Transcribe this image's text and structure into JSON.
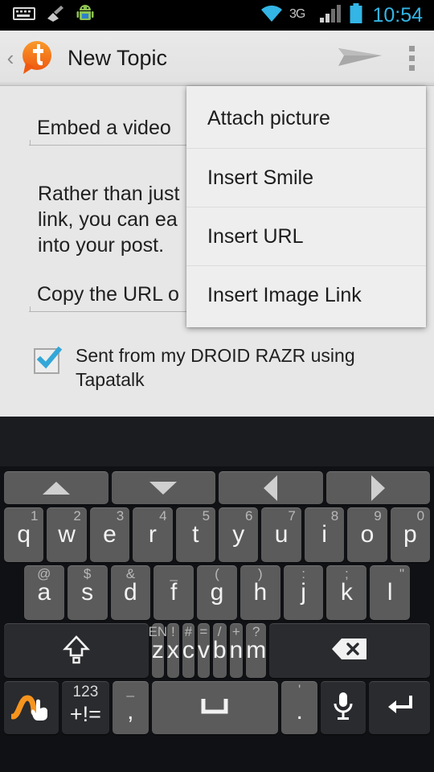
{
  "statusbar": {
    "time": "10:54",
    "network": "3G",
    "icons": [
      "keyboard-icon",
      "brush-icon",
      "android-robot-icon",
      "wifi-icon",
      "3g-label",
      "signal-icon",
      "battery-icon"
    ]
  },
  "actionbar": {
    "back_label": "‹",
    "app_logo": "tapatalk-logo",
    "title": "New Topic",
    "send_icon": "send-icon",
    "overflow_icon": "overflow-menu-icon"
  },
  "content": {
    "subject_value": "Embed a video ",
    "body_text": "Rather than just        link, you can ea  into your post.",
    "body_lines": [
      "Rather than just",
      "link, you can ea",
      "into your post."
    ],
    "url_value": "Copy the URL o",
    "signature": {
      "checked": true,
      "text": "Sent from my DROID RAZR using Tapatalk",
      "lines": [
        "Sent from my DROID RAZR using",
        "Tapatalk"
      ]
    }
  },
  "menu": {
    "items": [
      {
        "label": "Attach picture"
      },
      {
        "label": "Insert Smile"
      },
      {
        "label": "Insert URL"
      },
      {
        "label": "Insert Image Link"
      }
    ]
  },
  "keyboard": {
    "nav_row": [
      {
        "name": "arrow-up-key",
        "icon": "arrow-up-icon"
      },
      {
        "name": "arrow-down-key",
        "icon": "arrow-down-icon"
      },
      {
        "name": "arrow-left-key",
        "icon": "arrow-left-icon"
      },
      {
        "name": "arrow-right-key",
        "icon": "arrow-right-icon"
      }
    ],
    "row1": [
      {
        "main": "q",
        "hint": "1"
      },
      {
        "main": "w",
        "hint": "2"
      },
      {
        "main": "e",
        "hint": "3"
      },
      {
        "main": "r",
        "hint": "4"
      },
      {
        "main": "t",
        "hint": "5"
      },
      {
        "main": "y",
        "hint": "6"
      },
      {
        "main": "u",
        "hint": "7"
      },
      {
        "main": "i",
        "hint": "8"
      },
      {
        "main": "o",
        "hint": "9"
      },
      {
        "main": "p",
        "hint": "0"
      }
    ],
    "row2": [
      {
        "main": "a",
        "hint": "@"
      },
      {
        "main": "s",
        "hint": "$"
      },
      {
        "main": "d",
        "hint": "&"
      },
      {
        "main": "f",
        "hint": "_"
      },
      {
        "main": "g",
        "hint": "("
      },
      {
        "main": "h",
        "hint": ")"
      },
      {
        "main": "j",
        "hint": ":"
      },
      {
        "main": "k",
        "hint": ";"
      },
      {
        "main": "l",
        "hint": "\""
      }
    ],
    "row3": {
      "shift": {
        "name": "shift-key",
        "icon": "shift-arrow-icon"
      },
      "keys": [
        {
          "main": "z",
          "hint": "EN"
        },
        {
          "main": "x",
          "hint": "!"
        },
        {
          "main": "c",
          "hint": "#"
        },
        {
          "main": "v",
          "hint": "="
        },
        {
          "main": "b",
          "hint": "/"
        },
        {
          "main": "n",
          "hint": "+"
        },
        {
          "main": "m",
          "hint": "?"
        }
      ],
      "backspace": {
        "name": "backspace-key",
        "icon": "backspace-icon"
      }
    },
    "row4": {
      "gesture": {
        "name": "gesture-key",
        "icon": "swipe-hand-icon"
      },
      "symbols": {
        "name": "symbols-key",
        "sub": "123",
        "main": "+!="
      },
      "comma": {
        "name": "comma-key",
        "main": ",",
        "hint": "_"
      },
      "space": {
        "name": "space-key",
        "icon": "space-icon"
      },
      "period": {
        "name": "period-key",
        "main": ".",
        "hint": "'"
      },
      "mic": {
        "name": "microphone-key",
        "icon": "microphone-icon"
      },
      "enter": {
        "name": "enter-key",
        "icon": "enter-icon"
      }
    }
  },
  "colors": {
    "accent_blue": "#33b5e5",
    "brand_orange": "#f4731c",
    "content_bg": "#e7e7e7",
    "menu_bg": "#eeeeee",
    "key_bg": "#5b5b5b",
    "key_dark_bg": "#2a2b2e"
  }
}
